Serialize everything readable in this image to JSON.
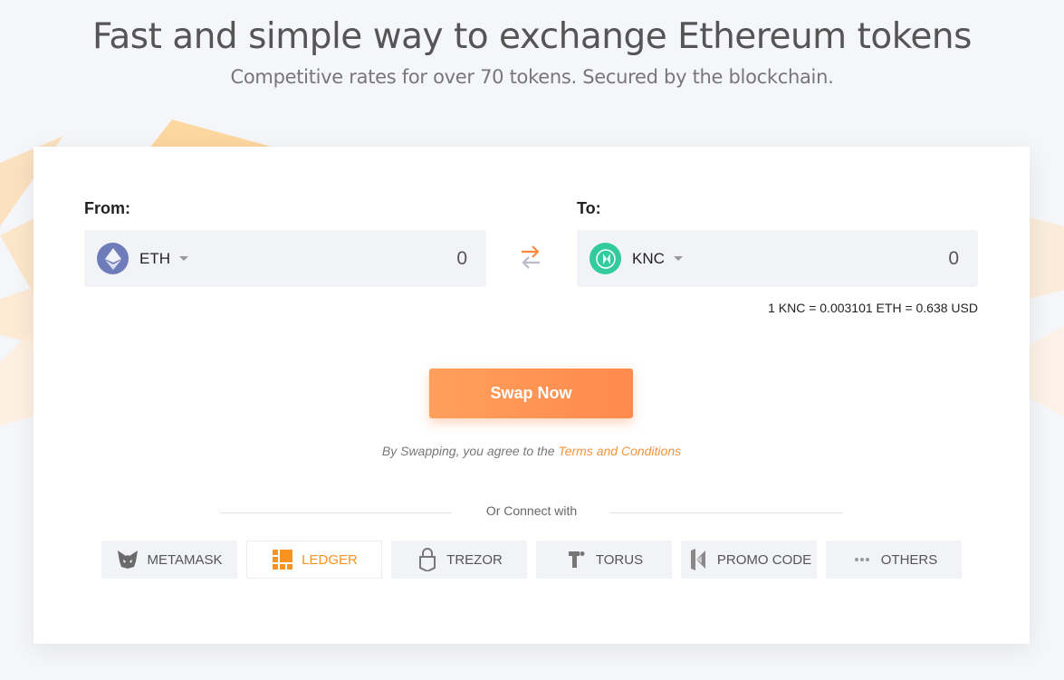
{
  "hero": {
    "title": "Fast and simple way to exchange Ethereum tokens",
    "subtitle": "Competitive rates for over 70 tokens. Secured by the blockchain."
  },
  "swap": {
    "from": {
      "label": "From:",
      "symbol": "ETH",
      "amount": "0",
      "icon": "ethereum-icon"
    },
    "to": {
      "label": "To:",
      "symbol": "KNC",
      "amount": "0",
      "icon": "kyber-icon"
    },
    "rate": "1 KNC = 0.003101 ETH = 0.638 USD",
    "button": "Swap Now",
    "terms_prefix": "By Swapping, you agree to the ",
    "terms_link": "Terms and Conditions"
  },
  "connect": {
    "label": "Or Connect with",
    "wallets": [
      {
        "label": "METAMASK",
        "icon": "metamask-icon"
      },
      {
        "label": "LEDGER",
        "icon": "ledger-icon",
        "active": true
      },
      {
        "label": "TREZOR",
        "icon": "trezor-icon"
      },
      {
        "label": "TORUS",
        "icon": "torus-icon"
      },
      {
        "label": "PROMO CODE",
        "icon": "promo-code-icon"
      },
      {
        "label": "OTHERS",
        "icon": "more-icon"
      }
    ]
  },
  "colors": {
    "accent": "#ff8a4d",
    "link": "#f7943a",
    "eth": "#6f7cba",
    "knc": "#31cb9e"
  }
}
